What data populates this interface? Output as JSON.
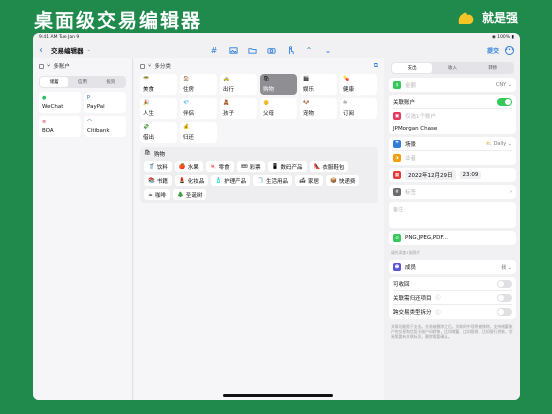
{
  "banner": {
    "title": "桌面级交易编辑器",
    "brand_name": "就是强"
  },
  "status": {
    "time": "9:41 AM",
    "date": "Tue Jan 9",
    "battery": "100%"
  },
  "nav": {
    "back": "‹",
    "title": "交易编辑器",
    "submit": "提交"
  },
  "accounts": {
    "header": "多账户",
    "tabs": [
      "储蓄",
      "信用",
      "投资"
    ],
    "items": [
      {
        "name": "WeChat",
        "icon": "wechat-icon",
        "color": "#2dbe60"
      },
      {
        "name": "PayPal",
        "icon": "paypal-icon",
        "color": "#1f5fb5"
      },
      {
        "name": "BOA",
        "icon": "boa-icon",
        "color": "#c8102e"
      },
      {
        "name": "Citibank",
        "icon": "citibank-icon",
        "color": "#1c6bb8"
      }
    ]
  },
  "categories": {
    "header": "多分类",
    "items": [
      {
        "name": "美食",
        "icon": "🥗"
      },
      {
        "name": "住房",
        "icon": "🏠"
      },
      {
        "name": "出行",
        "icon": "🚕"
      },
      {
        "name": "购物",
        "icon": "🛍",
        "selected": true
      },
      {
        "name": "娱乐",
        "icon": "🎬"
      },
      {
        "name": "健康",
        "icon": "💊"
      },
      {
        "name": "人生",
        "icon": "🎉"
      },
      {
        "name": "伴侣",
        "icon": "💎"
      },
      {
        "name": "孩子",
        "icon": "🧸"
      },
      {
        "name": "父母",
        "icon": "👴"
      },
      {
        "name": "宠物",
        "icon": "🐶"
      },
      {
        "name": "订阅",
        "icon": "♾"
      },
      {
        "name": "借出",
        "icon": "💸"
      },
      {
        "name": "归还",
        "icon": "💰"
      }
    ],
    "sub_header": "购物",
    "sub_items": [
      {
        "name": "饮料",
        "icon": "🥤"
      },
      {
        "name": "水果",
        "icon": "🍎"
      },
      {
        "name": "零食",
        "icon": "🍬"
      },
      {
        "name": "彩票",
        "icon": "🎟"
      },
      {
        "name": "数码产品",
        "icon": "📱"
      },
      {
        "name": "衣服鞋包",
        "icon": "👠"
      },
      {
        "name": "书籍",
        "icon": "📚"
      },
      {
        "name": "化妆品",
        "icon": "💄"
      },
      {
        "name": "护理产品",
        "icon": "🧴"
      },
      {
        "name": "生活用品",
        "icon": "🧻"
      },
      {
        "name": "家居",
        "icon": "🛋"
      },
      {
        "name": "快递费",
        "icon": "📦"
      },
      {
        "name": "咖啡",
        "icon": "☕"
      },
      {
        "name": "圣诞树",
        "icon": "🎄"
      }
    ]
  },
  "detail": {
    "tabs": [
      "支出",
      "收入",
      "转移"
    ],
    "amount_placeholder": "金额",
    "currency": "CNY",
    "linked_account_label": "关联账户",
    "linked_account_placeholder": "仅选1个账户",
    "linked_account_value": "JPMorgan Chase",
    "scene_label": "场景",
    "scene_value": "Daily",
    "merchant_placeholder": "业者",
    "date": "2022年12月29日",
    "time": "23:09",
    "tag_placeholder": "标签",
    "note_placeholder": "备注",
    "attachment": "PNG,JPEG,PDF...",
    "attachment_hint": "请先添加1张照片",
    "member_label": "成员",
    "member_value": "我",
    "refundable_label": "可收回",
    "linked_history_label": "关联需归还项目",
    "cross_category_label": "跨交易类型拆分",
    "fine_print": "关联功能限于支出。交易被删除之后，关联的中项将被移除。支持储蓄账户的交易和信用卡账户间转移，比如储蓄、比如报销、比如银行贷款，交易需要有关联标识。删除需要确认。"
  }
}
